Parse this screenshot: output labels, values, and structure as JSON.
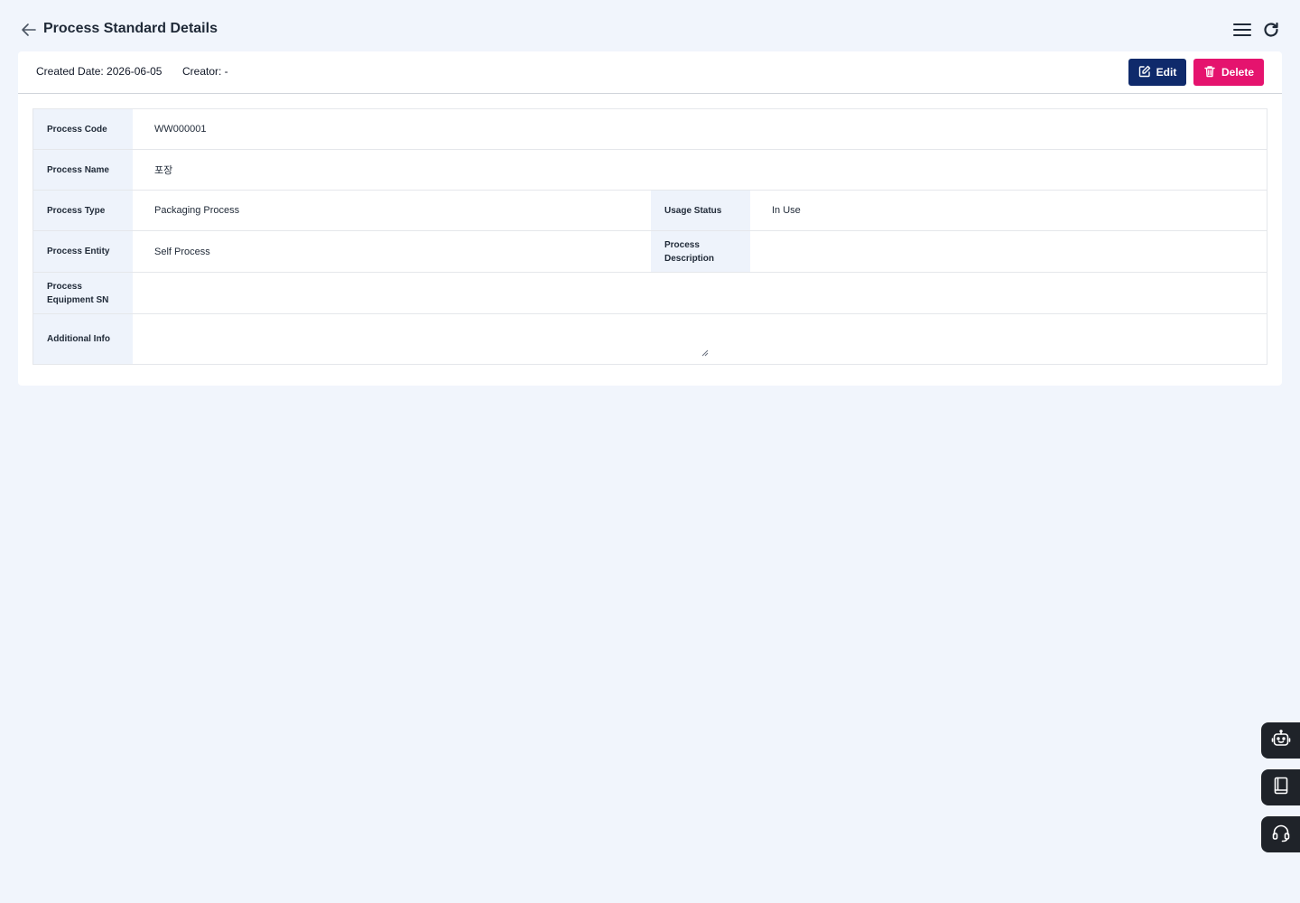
{
  "header": {
    "title": "Process Standard Details"
  },
  "meta": {
    "created": "Created Date: 2026-06-05",
    "creator": "Creator: -"
  },
  "actions": {
    "edit_label": "Edit",
    "delete_label": "Delete"
  },
  "fields": {
    "process_code": {
      "label": "Process Code",
      "value": "WW000001"
    },
    "process_name": {
      "label": "Process Name",
      "value": "포장"
    },
    "process_type": {
      "label": "Process Type",
      "value": "Packaging Process"
    },
    "usage_status": {
      "label": "Usage Status",
      "value": "In Use"
    },
    "process_entity": {
      "label": "Process Entity",
      "value": "Self Process"
    },
    "process_description": {
      "label": "Process Description",
      "value": ""
    },
    "equipment_sn": {
      "label": "Process Equipment SN",
      "value": ""
    },
    "additional_info": {
      "label": "Additional Info",
      "value": ""
    }
  },
  "colors": {
    "edit_button": "#0f2a6b",
    "delete_button": "#e5136e",
    "label_bg": "#eef3fb",
    "page_bg": "#f1f5fc"
  },
  "side_tools": [
    "chatbot-icon",
    "manual-book-icon",
    "support-headset-icon"
  ]
}
